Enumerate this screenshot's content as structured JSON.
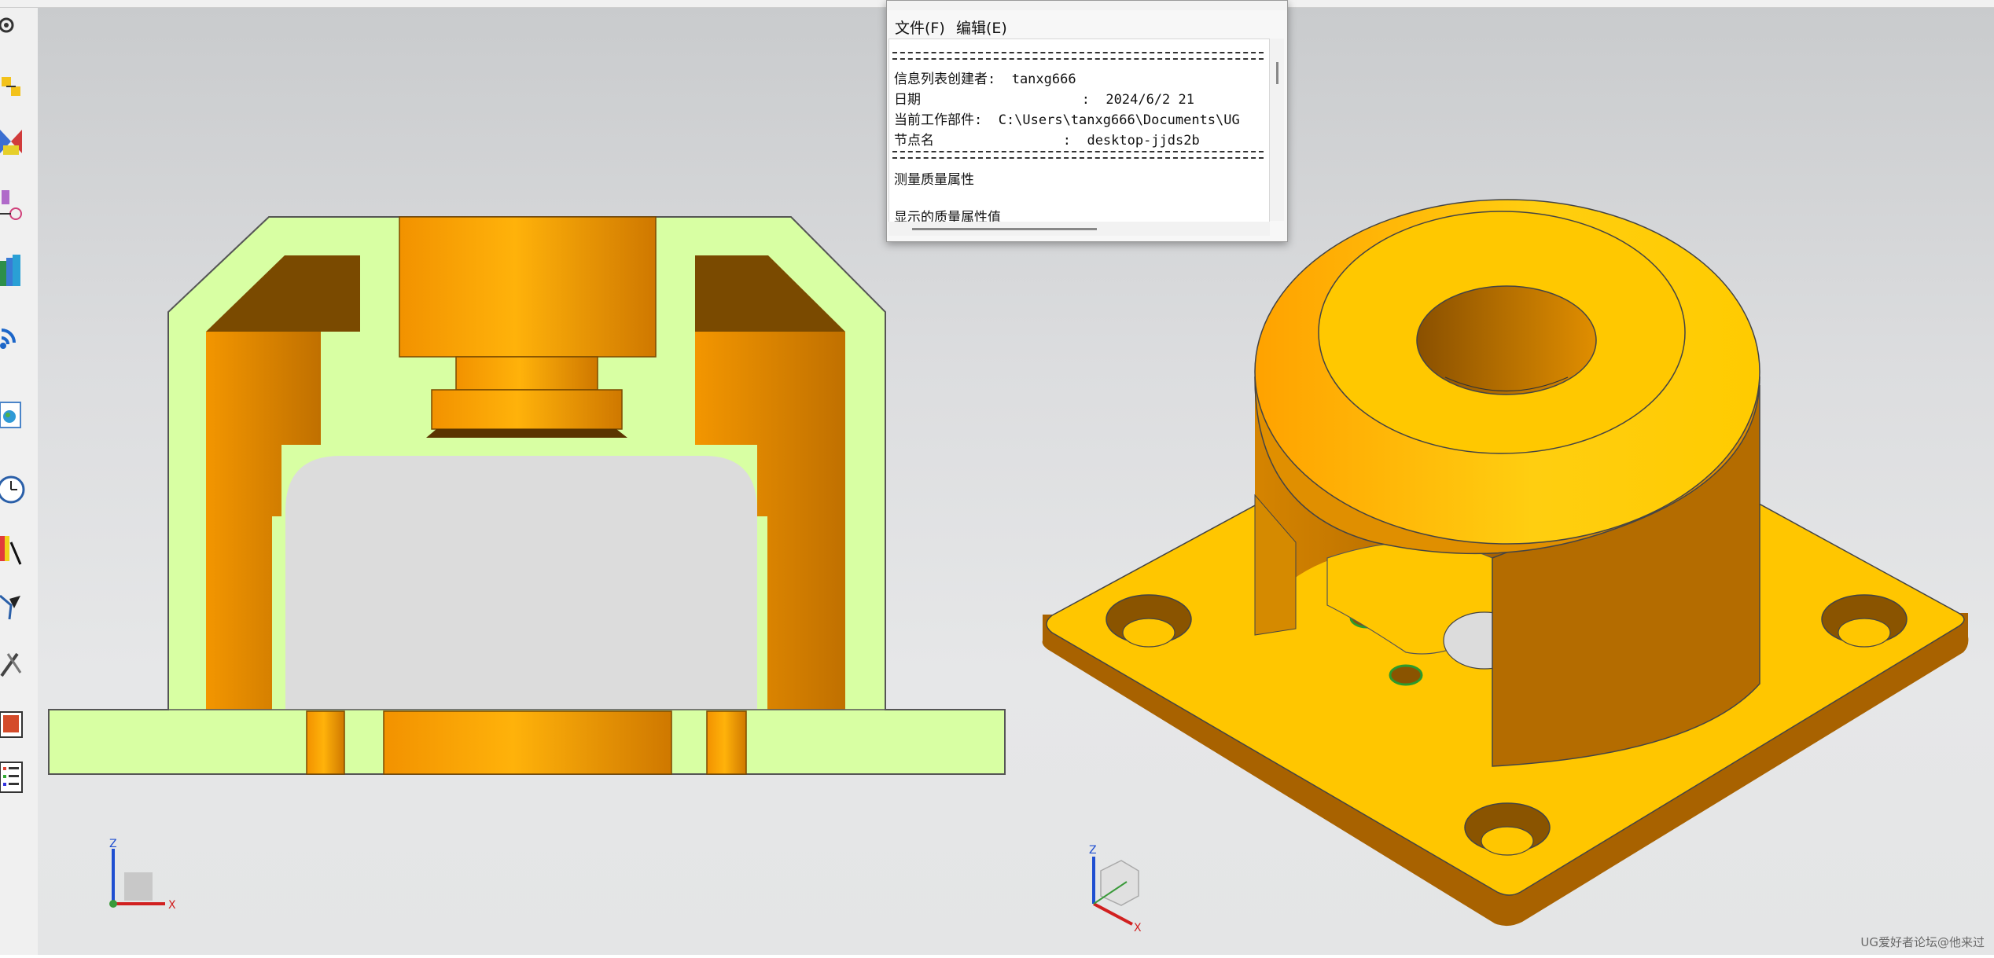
{
  "info_window": {
    "menu": {
      "file": "文件(F)",
      "edit": "编辑(E)"
    },
    "lines": {
      "creator": "信息列表创建者:  tanxg666",
      "date": "日期                    :  2024/6/2 21",
      "part": "当前工作部件:  C:\\Users\\tanxg666\\Documents\\UG",
      "node": "节点名                :  desktop-jjds2b",
      "measure": "测量质量属性",
      "displayed": "显示的质量属性值"
    }
  },
  "triads": {
    "left": {
      "z": "Z",
      "x": "X"
    },
    "right": {
      "z": "Z",
      "x": "X"
    }
  },
  "watermark": "UG爱好者论坛@他来过",
  "colors": {
    "section_fill": "#d8ffa3",
    "orange": "#f5a100",
    "gold": "#ffc400",
    "viewport_bg": "#dcdddf"
  },
  "toolbar_icons": [
    "settings-icon",
    "assembly-icon",
    "section-icon",
    "measure-icon",
    "library-icon",
    "signal-icon",
    "globe-icon",
    "clock-icon",
    "analysis-icon",
    "filter-icon",
    "tools-icon",
    "display-icon",
    "list-icon"
  ]
}
